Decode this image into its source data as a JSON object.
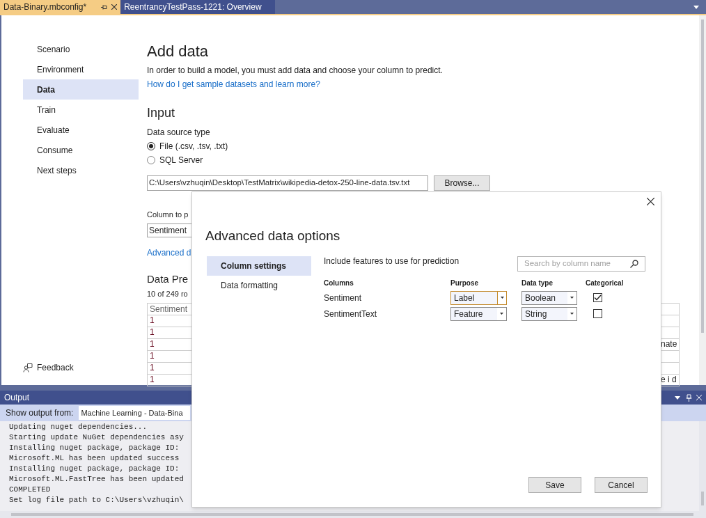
{
  "tabs": [
    {
      "label": "Data-Binary.mbconfig*",
      "selected": true
    },
    {
      "label": "ReentrancyTestPass-1221: Overview",
      "selected": false
    }
  ],
  "sidebar": {
    "items": [
      {
        "label": "Scenario",
        "selected": false
      },
      {
        "label": "Environment",
        "selected": false
      },
      {
        "label": "Data",
        "selected": true
      },
      {
        "label": "Train",
        "selected": false
      },
      {
        "label": "Evaluate",
        "selected": false
      },
      {
        "label": "Consume",
        "selected": false
      },
      {
        "label": "Next steps",
        "selected": false
      }
    ],
    "feedback": "Feedback"
  },
  "page": {
    "title": "Add data",
    "description": "In order to build a model, you must add data and choose your column to predict.",
    "help_link": "How do I get sample datasets and learn more?",
    "input": {
      "heading": "Input",
      "source_label": "Data source type",
      "sources": [
        {
          "label": "File (.csv, .tsv, .txt)",
          "selected": true
        },
        {
          "label": "SQL Server",
          "selected": false
        }
      ],
      "path": "C:\\Users\\vzhuqin\\Desktop\\TestMatrix\\wikipedia-detox-250-line-data.tsv.txt",
      "browse": "Browse..."
    },
    "predict_label": "Column to p",
    "predict_value": "Sentiment",
    "advanced_link": "Advanced d",
    "preview": {
      "heading": "Data Pre",
      "count": "10 of 249 ro",
      "header": "Sentiment",
      "rows": [
        {
          "value": "1"
        },
        {
          "value": "1"
        },
        {
          "value": "1",
          "fragment": "nate"
        },
        {
          "value": "1"
        },
        {
          "value": "1"
        },
        {
          "value": "1",
          "fragment": "e i d"
        }
      ]
    }
  },
  "output": {
    "title": "Output",
    "show_from_label": "Show output from:",
    "source": "Machine Learning - Data-Bina",
    "lines": [
      "Updating nuget dependencies...",
      "Starting update NuGet dependencies asy",
      "Installing nuget package, package ID:",
      "Microsoft.ML has been updated success",
      "Installing nuget package, package ID:",
      "Microsoft.ML.FastTree has been updated",
      "COMPLETED",
      "Set log file path to C:\\Users\\vzhuqin\\"
    ]
  },
  "dialog": {
    "title": "Advanced data options",
    "nav": [
      {
        "label": "Column settings",
        "selected": true
      },
      {
        "label": "Data formatting",
        "selected": false
      }
    ],
    "instruction": "Include features to use for prediction",
    "search_placeholder": "Search by column name",
    "columns": [
      "Columns",
      "Purpose",
      "Data type",
      "Categorical"
    ],
    "rows": [
      {
        "name": "Sentiment",
        "purpose": "Label",
        "purpose_focused": true,
        "data_type": "Boolean",
        "categorical": true
      },
      {
        "name": "SentimentText",
        "purpose": "Feature",
        "purpose_focused": false,
        "data_type": "String",
        "categorical": false
      }
    ],
    "buttons": [
      "Save",
      "Cancel"
    ]
  }
}
